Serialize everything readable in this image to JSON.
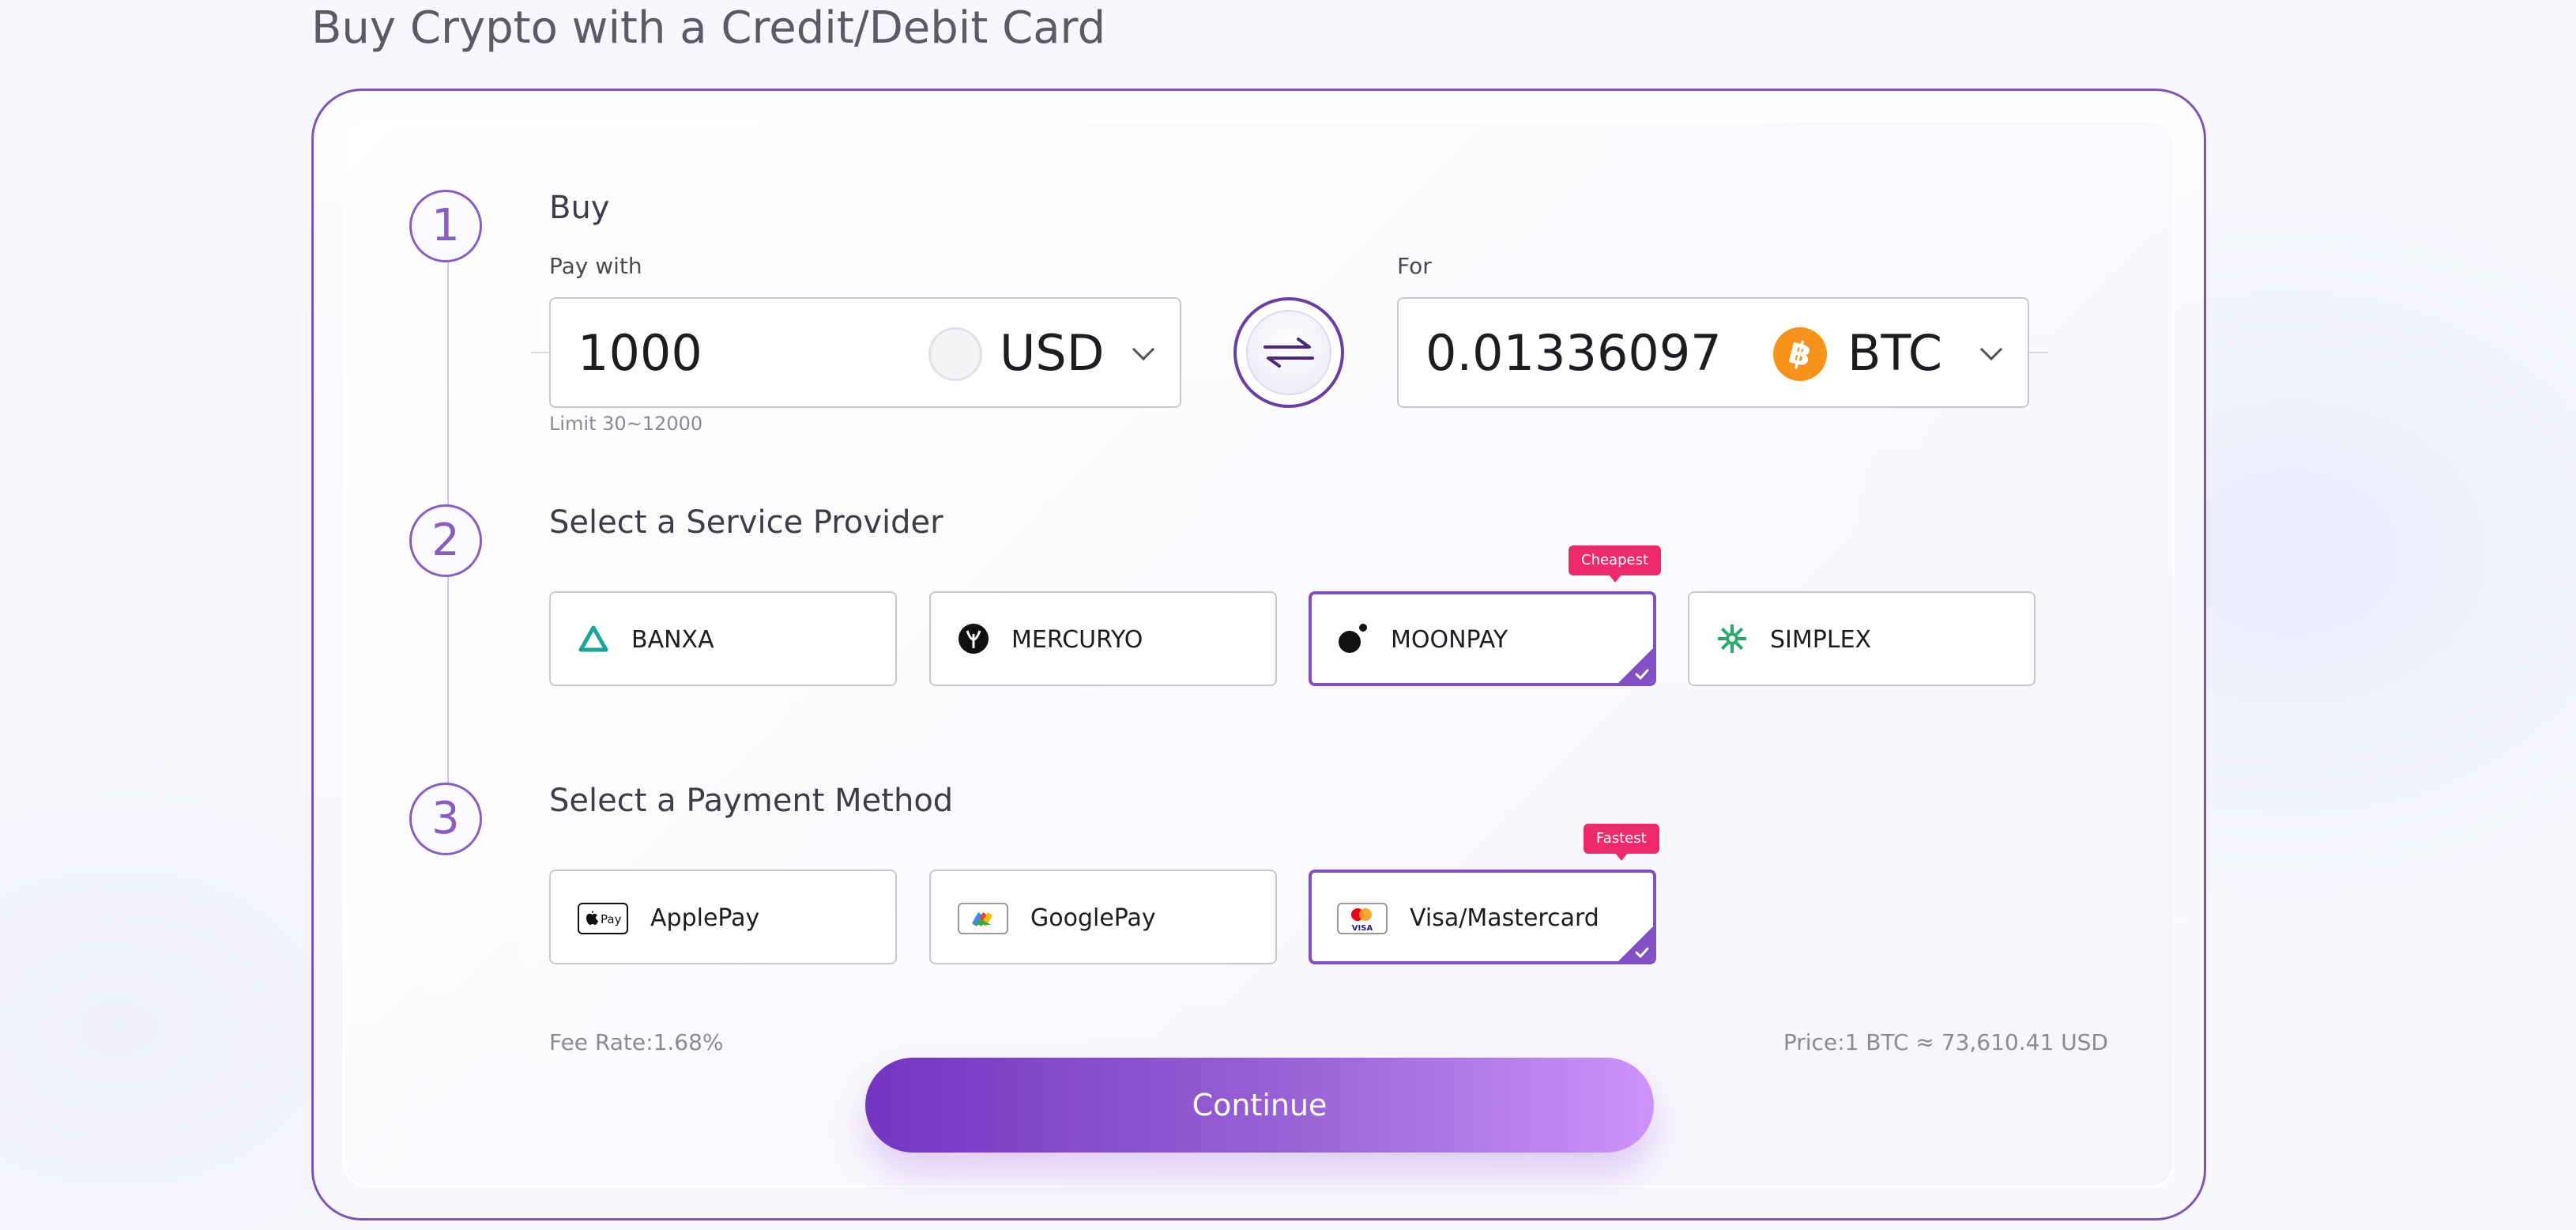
{
  "page": {
    "title": "Buy Crypto with a Credit/Debit Card"
  },
  "steps": {
    "one": {
      "number": "1",
      "title": "Buy"
    },
    "two": {
      "number": "2",
      "title": "Select a Service Provider"
    },
    "three": {
      "number": "3",
      "title": "Select a Payment Method"
    }
  },
  "buy": {
    "pay_with_label": "Pay with",
    "pay_amount": "1000",
    "pay_currency": "USD",
    "pay_currency_icon": "usd-flag-icon",
    "limit_hint": "Limit 30~12000",
    "swap_icon": "swap-arrows-icon",
    "for_label": "For",
    "receive_amount": "0.01336097",
    "receive_currency": "BTC",
    "receive_currency_icon": "bitcoin-icon"
  },
  "providers": {
    "banxa": {
      "label": "BANXA",
      "icon": "banxa-logo-icon",
      "selected": false
    },
    "mercuryo": {
      "label": "MERCURYO",
      "icon": "mercuryo-logo-icon",
      "selected": false
    },
    "moonpay": {
      "label": "MOONPAY",
      "icon": "moonpay-logo-icon",
      "selected": true,
      "tag": "Cheapest"
    },
    "simplex": {
      "label": "SIMPLEX",
      "icon": "simplex-logo-icon",
      "selected": false
    }
  },
  "payment_methods": {
    "applepay": {
      "label": "ApplePay",
      "icon": "apple-pay-icon",
      "selected": false
    },
    "googlepay": {
      "label": "GooglePay",
      "icon": "google-pay-icon",
      "selected": false
    },
    "card": {
      "label": "Visa/Mastercard",
      "icon": "visa-mastercard-icon",
      "selected": true,
      "tag": "Fastest"
    }
  },
  "footer": {
    "fee_rate": "Fee Rate:1.68%",
    "price": "Price:1 BTC ≈ 73,610.41 USD",
    "continue_label": "Continue"
  },
  "colors": {
    "accent": "#8150c4",
    "tag": "#ee2a6b",
    "bitcoin": "#f7931a",
    "continue_start": "#7434c1",
    "continue_end": "#cd93fb"
  }
}
